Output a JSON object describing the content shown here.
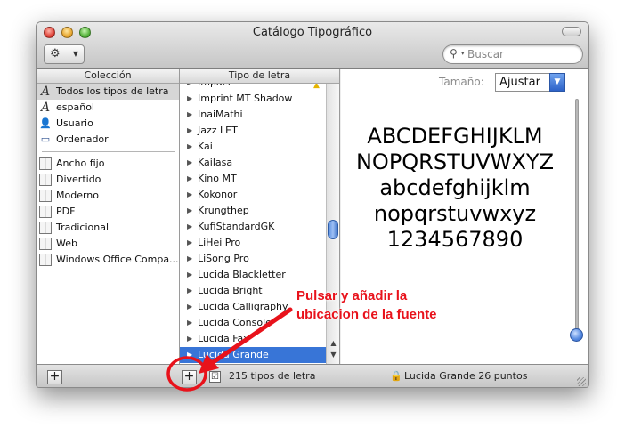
{
  "window": {
    "title": "Catálogo Tipográfico"
  },
  "toolbar": {
    "gear_icon": "gear-icon",
    "search_placeholder": "Buscar"
  },
  "collection": {
    "header": "Colección",
    "items": [
      {
        "label": "Todos los tipos de letra",
        "icon": "font-a-icon"
      },
      {
        "label": "español",
        "icon": "font-a-icon"
      },
      {
        "label": "Usuario",
        "icon": "user-icon"
      },
      {
        "label": "Ordenador",
        "icon": "computer-icon"
      }
    ],
    "groups": [
      {
        "label": "Ancho fijo"
      },
      {
        "label": "Divertido"
      },
      {
        "label": "Moderno"
      },
      {
        "label": "PDF"
      },
      {
        "label": "Tradicional"
      },
      {
        "label": "Web"
      },
      {
        "label": "Windows Office Compa..."
      }
    ]
  },
  "fonts": {
    "header": "Tipo de letra",
    "items": [
      "Impact",
      "Imprint MT Shadow",
      "InaiMathi",
      "Jazz LET",
      "Kai",
      "Kailasa",
      "Kino MT",
      "Kokonor",
      "Krungthep",
      "KufiStandardGK",
      "LiHei Pro",
      "LiSong Pro",
      "Lucida Blackletter",
      "Lucida Bright",
      "Lucida Calligraphy",
      "Lucida Console",
      "Lucida Fax",
      "Lucida Grande"
    ],
    "selected": "Lucida Grande"
  },
  "preview": {
    "size_label": "Tamaño:",
    "size_value": "Ajustar",
    "lines": [
      "ABCDEFGHIJKLM",
      "NOPQRSTUVWXYZ",
      "abcdefghijklm",
      "nopqrstuvwxyz",
      "1234567890"
    ]
  },
  "bottom": {
    "add_collection": "+",
    "add_font": "+",
    "check_mark": "☑",
    "count": "215 tipos de letra",
    "status": "Lucida Grande 26 puntos"
  },
  "annotation": {
    "line1": "Pulsar y añadir la",
    "line2": "ubicacion de la fuente",
    "color": "#e8121b"
  }
}
